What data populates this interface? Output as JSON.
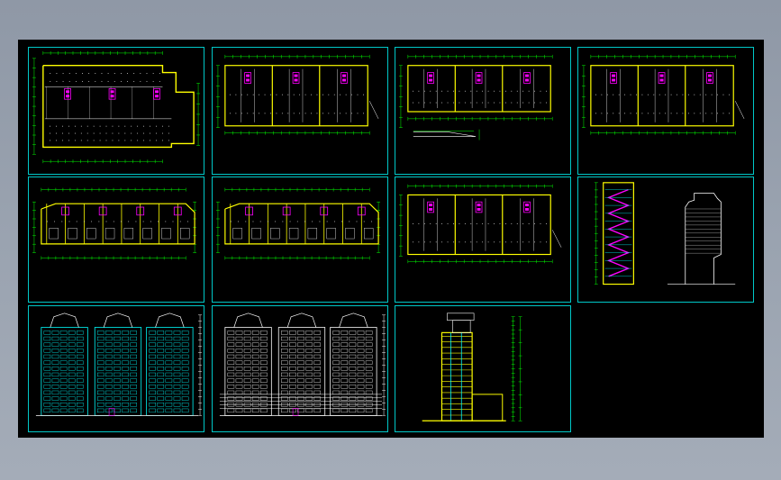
{
  "watermark": "",
  "colors": {
    "background": "#000000",
    "frame": "#00c8c8",
    "wall": "#ffff00",
    "grid": "#00ff00",
    "accent": "#ff00ff",
    "line": "#ffffff",
    "facade": "#00ffff"
  },
  "sheets": [
    {
      "id": "plan-1",
      "kind": "plan-large",
      "caption": ""
    },
    {
      "id": "plan-2",
      "kind": "plan-three",
      "caption": ""
    },
    {
      "id": "plan-3",
      "kind": "plan-three-section",
      "caption": ""
    },
    {
      "id": "plan-4",
      "kind": "plan-three",
      "caption": ""
    },
    {
      "id": "plan-5",
      "kind": "plan-units",
      "caption": ""
    },
    {
      "id": "plan-6",
      "kind": "plan-units",
      "caption": ""
    },
    {
      "id": "plan-7",
      "kind": "plan-three",
      "caption": ""
    },
    {
      "id": "stair-section",
      "kind": "section-stair",
      "caption": ""
    },
    {
      "id": "elevation-front",
      "kind": "elevation",
      "caption": ""
    },
    {
      "id": "elevation-rear",
      "kind": "elevation-white",
      "caption": ""
    },
    {
      "id": "side-section",
      "kind": "section-side",
      "caption": ""
    }
  ]
}
